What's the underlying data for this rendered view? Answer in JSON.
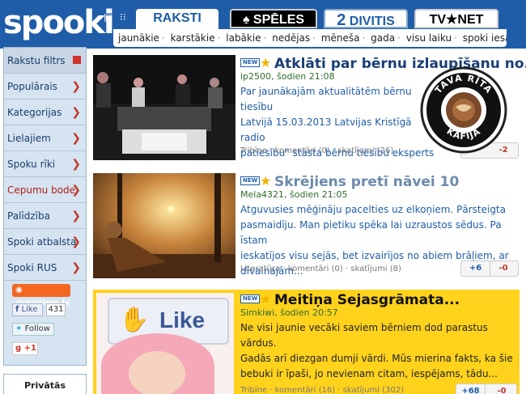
{
  "header": {
    "logo": "spooki",
    "tabs": [
      {
        "label": "RAKSTI"
      },
      {
        "label": "SPĒLES"
      },
      {
        "label": "DIVITIS"
      },
      {
        "label": "TV★NET"
      }
    ],
    "divitis_number": "2",
    "subnav": [
      "jaunākie",
      "karstākie",
      "labākie",
      "nedējas",
      "mēneša",
      "gada",
      "visu laiku",
      "spoki iesaka"
    ]
  },
  "sidebar": {
    "items": [
      {
        "label": "Rakstu filtrs"
      },
      {
        "label": "Populārais"
      },
      {
        "label": "Kategorijas"
      },
      {
        "label": "Lielajiem"
      },
      {
        "label": "Spoku rīki"
      },
      {
        "label": "Cepumu bode"
      },
      {
        "label": "Palīdzība"
      },
      {
        "label": "Spoki atbalsta"
      },
      {
        "label": "Spoki RUS"
      }
    ],
    "social": {
      "draugiem": "draugiem.lv",
      "like": "Like",
      "like_count": "431",
      "follow": "Follow",
      "gplus": "+1"
    },
    "gallery": "Privātās galerijas"
  },
  "articles": [
    {
      "new": "NEW",
      "title": "Atklāti par bērnu izlaupīšanu no...",
      "meta": "ip2500, šodien 21:08",
      "text": [
        "Par jaunākajām aktualitātēm bērnu tiesību",
        "Latvijā 15.03.2013 Latvijas Kristīgā radio",
        "patiesību\" stāsta bērnu tiesību eksperts"
      ],
      "foot": "Tribīne · komentāri (0) · skatījumi (26)",
      "plus": "",
      "minus": "-2"
    },
    {
      "new": "NEW",
      "title": "Skrējiens pretī nāvei 10",
      "meta": "Mela4321, šodien 21:05",
      "text": [
        "Atguvusies mēģināju pacelties uz elkoņiem. Pārsteigta",
        "pasmaidīju. Man pietiku spēka lai uzraustos sēdus. Pa īstam",
        "ieskatījos visu sejās, bet izvairījos no abiem brāļiem, ar",
        "dīvainajām..."
      ],
      "foot": "Literatūra · komentāri (0) · skatījumi (8)",
      "plus": "+6",
      "minus": "-0"
    },
    {
      "new": "NEW",
      "title": "Meitiņa Sejasgrāmata...",
      "meta": "Simkiwi, šodien 20:57",
      "text": [
        "Ne visi jaunie vecāki saviem bērniem dod parastus vārdus.",
        "Gadās arī diezgan dumji vārdi. Mūs mierina fakts, ka šie",
        "bebuki ir īpaši, jo nevienam citam, iespējams, tādu..."
      ],
      "foot": "Tribīne · komentāri (16) · skatījumi (302)",
      "plus": "+68",
      "minus": "-0",
      "thumb_text": "Like"
    }
  ],
  "badge": {
    "top": "TAVA RĪTA",
    "bottom": "KAFIJA"
  },
  "colors": {
    "brand": "#1f5da8",
    "highlight": "#ffd21c",
    "accent_red": "#d0312d"
  }
}
